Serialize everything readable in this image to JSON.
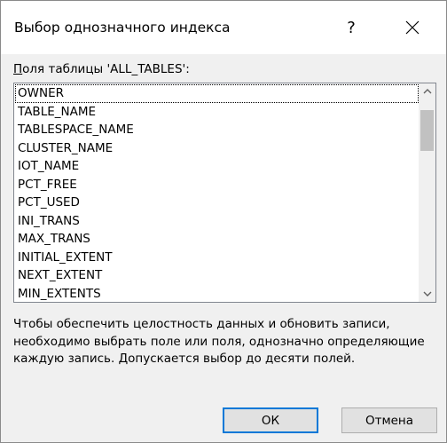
{
  "window": {
    "title": "Выбор однозначного индекса",
    "help_label": "?",
    "close_icon": "close-icon"
  },
  "fields": {
    "label_prefix": "П",
    "label_rest": "оля таблицы 'ALL_TABLES':",
    "items": [
      "OWNER",
      "TABLE_NAME",
      "TABLESPACE_NAME",
      "CLUSTER_NAME",
      "IOT_NAME",
      "PCT_FREE",
      "PCT_USED",
      "INI_TRANS",
      "MAX_TRANS",
      "INITIAL_EXTENT",
      "NEXT_EXTENT",
      "MIN_EXTENTS"
    ],
    "focused_index": 0
  },
  "description": "Чтобы обеспечить целостность данных и обновить записи, необходимо выбрать поле или поля, однозначно определяющие каждую запись. Допускается выбор до десяти полей.",
  "buttons": {
    "ok_label": "ОК",
    "cancel_label": "Отмена"
  },
  "colors": {
    "accent": "#0078d7",
    "background": "#f0f0f0"
  }
}
